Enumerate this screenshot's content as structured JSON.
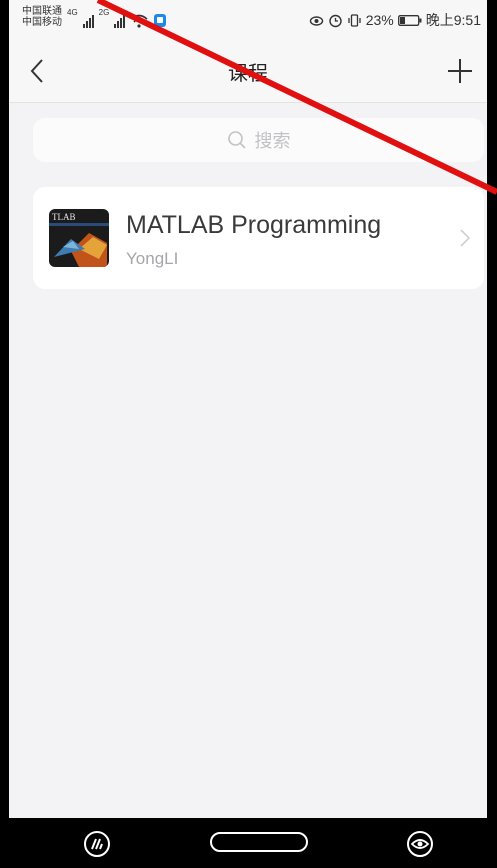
{
  "status_bar": {
    "carrier_1": "中国联通",
    "carrier_2": "中国移动",
    "network_1": "4G",
    "network_2": "2G",
    "battery": "23%",
    "time": "晚上9:51"
  },
  "nav": {
    "title": "课程"
  },
  "search": {
    "placeholder": "搜索"
  },
  "courses": [
    {
      "title": "MATLAB Programming",
      "author": "YongLI",
      "thumb_text": "TLAB"
    }
  ],
  "colors": {
    "annotation": "#e01010",
    "background": "#f3f3f5",
    "card": "#ffffff"
  }
}
